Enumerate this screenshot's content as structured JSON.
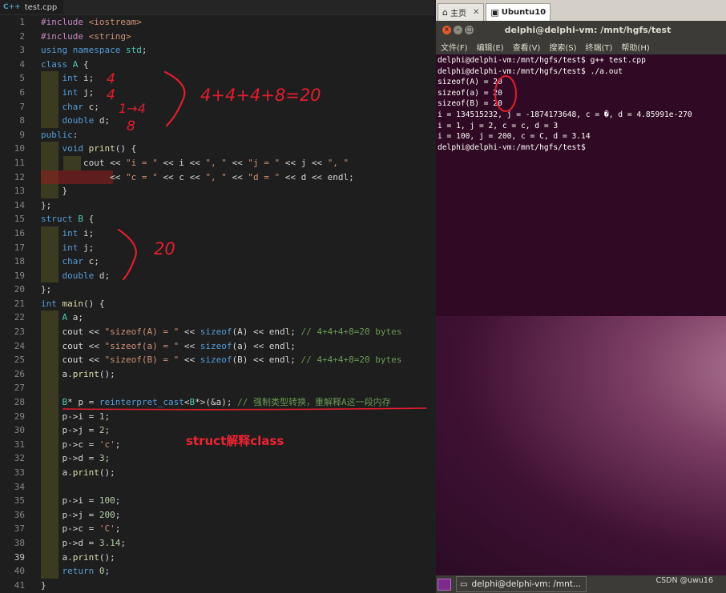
{
  "editor": {
    "tab": {
      "icon": "C++",
      "filename": "test.cpp"
    },
    "active_line": 39,
    "lines": [
      [
        [
          "pp",
          "#include "
        ],
        [
          "st",
          "<iostream>"
        ]
      ],
      [
        [
          "pp",
          "#include "
        ],
        [
          "st",
          "<string>"
        ]
      ],
      [
        [
          "kw",
          "using namespace "
        ],
        [
          "ty",
          "std"
        ],
        [
          "",
          ";"
        ]
      ],
      [
        [
          "kw",
          "class "
        ],
        [
          "ty",
          "A"
        ],
        [
          "",
          " {"
        ]
      ],
      [
        [
          "",
          "    "
        ],
        [
          "kw",
          "int"
        ],
        [
          "",
          " i;"
        ]
      ],
      [
        [
          "",
          "    "
        ],
        [
          "kw",
          "int"
        ],
        [
          "",
          " j;"
        ]
      ],
      [
        [
          "",
          "    "
        ],
        [
          "kw",
          "char"
        ],
        [
          "",
          " c;"
        ]
      ],
      [
        [
          "",
          "    "
        ],
        [
          "kw",
          "double"
        ],
        [
          "",
          " d;"
        ]
      ],
      [
        [
          "kw",
          "public"
        ],
        [
          "",
          ":"
        ]
      ],
      [
        [
          "",
          "    "
        ],
        [
          "kw",
          "void "
        ],
        [
          "fn",
          "print"
        ],
        [
          "",
          "() {"
        ]
      ],
      [
        [
          "",
          "        cout << "
        ],
        [
          "st",
          "\"i = \""
        ],
        [
          "",
          " << i << "
        ],
        [
          "st",
          "\", \""
        ],
        [
          "",
          " << "
        ],
        [
          "st",
          "\"j = \""
        ],
        [
          "",
          " << j << "
        ],
        [
          "st",
          "\", \""
        ]
      ],
      [
        [
          "",
          "             << "
        ],
        [
          "st",
          "\"c = \""
        ],
        [
          "",
          " << c << "
        ],
        [
          "st",
          "\", \""
        ],
        [
          "",
          " << "
        ],
        [
          "st",
          "\"d = \""
        ],
        [
          "",
          " << d << endl;"
        ]
      ],
      [
        [
          "",
          "    }"
        ]
      ],
      [
        [
          "",
          "};"
        ]
      ],
      [
        [
          "kw",
          "struct "
        ],
        [
          "ty",
          "B"
        ],
        [
          "",
          " {"
        ]
      ],
      [
        [
          "",
          "    "
        ],
        [
          "kw",
          "int"
        ],
        [
          "",
          " i;"
        ]
      ],
      [
        [
          "",
          "    "
        ],
        [
          "kw",
          "int"
        ],
        [
          "",
          " j;"
        ]
      ],
      [
        [
          "",
          "    "
        ],
        [
          "kw",
          "char"
        ],
        [
          "",
          " c;"
        ]
      ],
      [
        [
          "",
          "    "
        ],
        [
          "kw",
          "double"
        ],
        [
          "",
          " d;"
        ]
      ],
      [
        [
          "",
          "};"
        ]
      ],
      [
        [
          "kw",
          "int "
        ],
        [
          "fn",
          "main"
        ],
        [
          "",
          "() {"
        ]
      ],
      [
        [
          "",
          "    "
        ],
        [
          "ty",
          "A"
        ],
        [
          "",
          " a;"
        ]
      ],
      [
        [
          "",
          "    cout << "
        ],
        [
          "st",
          "\"sizeof(A) = \""
        ],
        [
          "",
          " << "
        ],
        [
          "kw",
          "sizeof"
        ],
        [
          "",
          "(A) << endl; "
        ],
        [
          "cm",
          "// 4+4+4+8=20 bytes"
        ]
      ],
      [
        [
          "",
          "    cout << "
        ],
        [
          "st",
          "\"sizeof(a) = \""
        ],
        [
          "",
          " << "
        ],
        [
          "kw",
          "sizeof"
        ],
        [
          "",
          "(a) << endl;"
        ]
      ],
      [
        [
          "",
          "    cout << "
        ],
        [
          "st",
          "\"sizeof(B) = \""
        ],
        [
          "",
          " << "
        ],
        [
          "kw",
          "sizeof"
        ],
        [
          "",
          "(B) << endl; "
        ],
        [
          "cm",
          "// 4+4+4+8=20 bytes"
        ]
      ],
      [
        [
          "",
          "    a."
        ],
        [
          "fn",
          "print"
        ],
        [
          "",
          "();"
        ]
      ],
      [],
      [
        [
          "",
          "    "
        ],
        [
          "ty",
          "B"
        ],
        [
          "",
          "* p = "
        ],
        [
          "kw",
          "reinterpret_cast"
        ],
        [
          "",
          "<"
        ],
        [
          "ty",
          "B"
        ],
        [
          "",
          "*>(&a); "
        ],
        [
          "cm",
          "// 强制类型转换，重解释A这一段内存"
        ]
      ],
      [
        [
          "",
          "    p->i = "
        ],
        [
          "nu",
          "1"
        ],
        [
          "",
          ";"
        ]
      ],
      [
        [
          "",
          "    p->j = "
        ],
        [
          "nu",
          "2"
        ],
        [
          "",
          ";"
        ]
      ],
      [
        [
          "",
          "    p->c = "
        ],
        [
          "st",
          "'c'"
        ],
        [
          "",
          ";"
        ]
      ],
      [
        [
          "",
          "    p->d = "
        ],
        [
          "nu",
          "3"
        ],
        [
          "",
          ";"
        ]
      ],
      [
        [
          "",
          "    a."
        ],
        [
          "fn",
          "print"
        ],
        [
          "",
          "();"
        ]
      ],
      [],
      [
        [
          "",
          "    p->i = "
        ],
        [
          "nu",
          "100"
        ],
        [
          "",
          ";"
        ]
      ],
      [
        [
          "",
          "    p->j = "
        ],
        [
          "nu",
          "200"
        ],
        [
          "",
          ";"
        ]
      ],
      [
        [
          "",
          "    p->c = "
        ],
        [
          "st",
          "'C'"
        ],
        [
          "",
          ";"
        ]
      ],
      [
        [
          "",
          "    p->d = "
        ],
        [
          "nu",
          "3.14"
        ],
        [
          "",
          ";"
        ]
      ],
      [
        [
          "",
          "    a."
        ],
        [
          "fn",
          "print"
        ],
        [
          "",
          "();"
        ]
      ],
      [
        [
          "",
          "    "
        ],
        [
          "kw",
          "return "
        ],
        [
          "nu",
          "0"
        ],
        [
          "",
          ";"
        ]
      ],
      [
        [
          "",
          "}"
        ]
      ]
    ]
  },
  "annotations": {
    "size_i": "4",
    "size_j": "4",
    "size_c": "1→4",
    "size_d": "8",
    "sum_class": "4+4+4+8=20",
    "sum_struct": "20",
    "caption": "struct解释class"
  },
  "vm_tabs": [
    {
      "icon": "home-icon",
      "label": "主页",
      "active": false
    },
    {
      "icon": "vm-icon",
      "label": "Ubuntu10",
      "active": true
    }
  ],
  "terminal": {
    "title": "delphi@delphi-vm: /mnt/hgfs/test",
    "menu": [
      "文件(F)",
      "编辑(E)",
      "查看(V)",
      "搜索(S)",
      "终端(T)",
      "帮助(H)"
    ],
    "lines": [
      "delphi@delphi-vm:/mnt/hgfs/test$ g++ test.cpp",
      "delphi@delphi-vm:/mnt/hgfs/test$ ./a.out",
      "sizeof(A) = 20",
      "sizeof(a) = 20",
      "sizeof(B) = 20",
      "i = 134515232, j = -1874173648, c = �, d = 4.85991e-270",
      "i = 1, j = 2, c = c, d = 3",
      "i = 100, j = 200, c = C, d = 3.14",
      "delphi@delphi-vm:/mnt/hgfs/test$"
    ]
  },
  "taskbar": {
    "item_label": "delphi@delphi-vm: /mnt..."
  },
  "watermark": "CSDN @uwu16",
  "colors": {
    "ink": "#e21d2f",
    "term_bg": "#300a24",
    "editor_bg": "#1e1e1e"
  }
}
